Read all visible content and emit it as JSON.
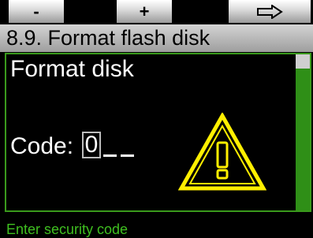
{
  "softkeys": {
    "left_label": "-",
    "middle_label": "+",
    "right_icon": "arrow-right-outline-icon"
  },
  "title": "8.9. Format flash disk",
  "panel": {
    "heading": "Format disk",
    "code_label": "Code:",
    "code_value": "0",
    "warning_icon": "warning-triangle-icon"
  },
  "status_text": "Enter security code",
  "colors": {
    "accent_green": "#3a9a1c",
    "warning_yellow": "#ffef00",
    "status_green": "#3fbf20"
  }
}
